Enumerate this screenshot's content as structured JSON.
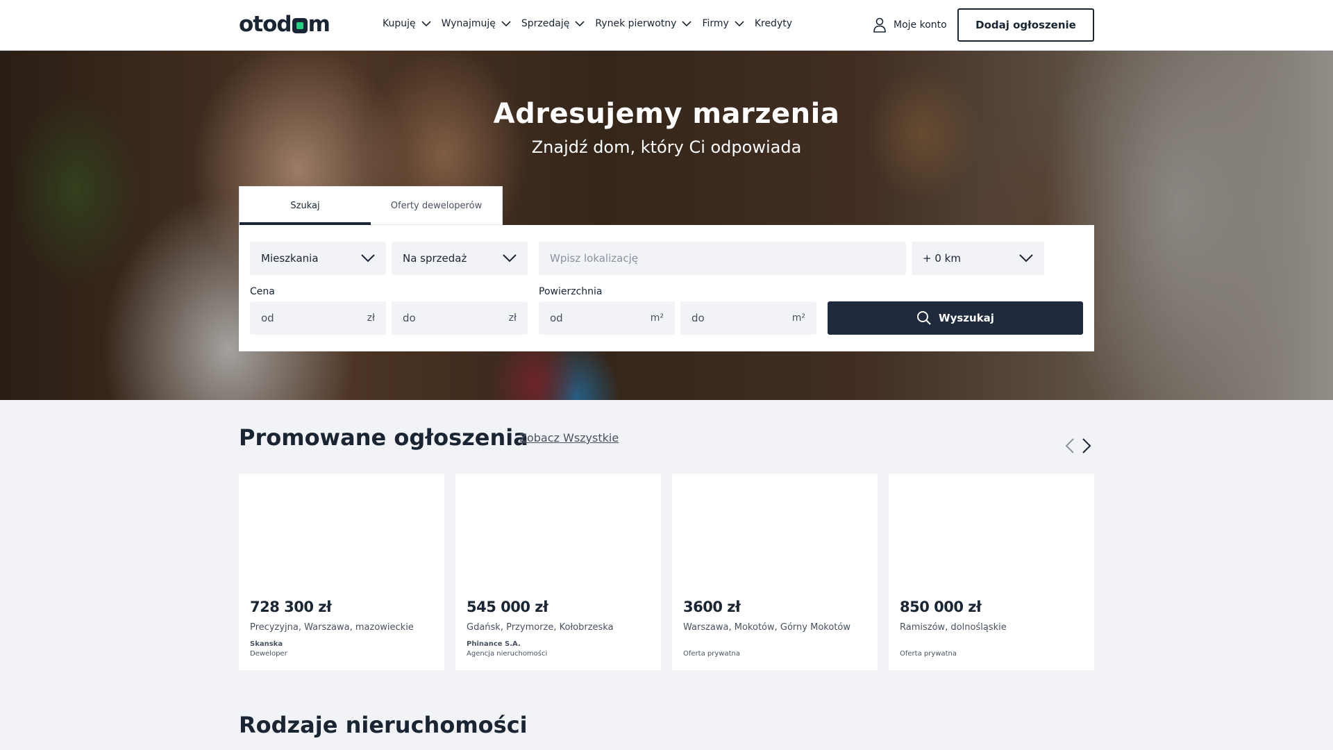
{
  "header": {
    "logo": "otodom",
    "nav": [
      {
        "label": "Kupuję",
        "has_dropdown": true
      },
      {
        "label": "Wynajmuję",
        "has_dropdown": true
      },
      {
        "label": "Sprzedaję",
        "has_dropdown": true
      },
      {
        "label": "Rynek pierwotny",
        "has_dropdown": true
      },
      {
        "label": "Firmy",
        "has_dropdown": true
      },
      {
        "label": "Kredyty",
        "has_dropdown": false
      }
    ],
    "account_label": "Moje konto",
    "add_button": "Dodaj ogłoszenie"
  },
  "hero": {
    "title": "Adresujemy marzenia",
    "subtitle": "Znajdź dom, który Ci odpowiada"
  },
  "search": {
    "tabs": [
      {
        "label": "Szukaj",
        "active": true
      },
      {
        "label": "Oferty deweloperów",
        "active": false
      }
    ],
    "property_type": "Mieszkania",
    "transaction": "Na sprzedaż",
    "location_placeholder": "Wpisz lokalizację",
    "radius": "+ 0 km",
    "price_label": "Cena",
    "price_from_placeholder": "od",
    "price_to_placeholder": "do",
    "price_unit": "zł",
    "area_label": "Powierzchnia",
    "area_from_placeholder": "od",
    "area_to_placeholder": "do",
    "area_unit": "m²",
    "search_button": "Wyszukaj"
  },
  "promoted": {
    "title": "Promowane ogłoszenia",
    "see_all": "Zobacz Wszystkie",
    "listings": [
      {
        "price": "728 300 zł",
        "location": "Precyzyjna, Warszawa, mazowieckie",
        "agent": "Skanska",
        "agent_type": "Deweloper"
      },
      {
        "price": "545 000 zł",
        "location": "Gdańsk, Przymorze, Kołobrzeska",
        "agent": "Phinance S.A.",
        "agent_type": "Agencja nieruchomości"
      },
      {
        "price": "3600 zł",
        "location": "Warszawa, Mokotów, Górny Mokotów",
        "agent": "",
        "agent_type": "Oferta prywatna"
      },
      {
        "price": "850 000 zł",
        "location": "Ramiszów, dolnośląskie",
        "agent": "",
        "agent_type": "Oferta prywatna"
      }
    ]
  },
  "property_types": {
    "title": "Rodzaje nieruchomości"
  },
  "colors": {
    "brand_dark": "#1a2533",
    "brand_green": "#23d07f",
    "page_bg": "#f1f3f6",
    "button_dark": "#1f2b3d"
  }
}
